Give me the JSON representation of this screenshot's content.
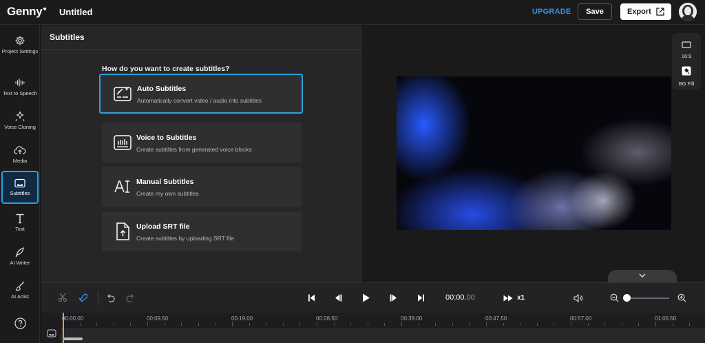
{
  "app": {
    "logo": "Genny",
    "logo_mark": "♥",
    "project_title": "Untitled"
  },
  "header": {
    "upgrade_label": "UPGRADE",
    "save_label": "Save",
    "export_label": "Export"
  },
  "sidebar": {
    "items": [
      {
        "label": "Project Settings",
        "icon": "gear-icon"
      },
      {
        "label": "Text to Speech",
        "icon": "waveform-icon"
      },
      {
        "label": "Voice Cloning",
        "icon": "sparkle-icon"
      },
      {
        "label": "Media",
        "icon": "cloud-upload-icon"
      },
      {
        "label": "Subtitles",
        "icon": "subtitles-icon",
        "active": true
      },
      {
        "label": "Text",
        "icon": "text-t-icon"
      },
      {
        "label": "AI Writer",
        "icon": "pen-icon"
      },
      {
        "label": "AI Artist",
        "icon": "brush-icon"
      },
      {
        "label": "",
        "icon": "help-icon"
      }
    ]
  },
  "panel": {
    "title": "Subtitles",
    "question": "How do you want to create subtitles?",
    "options": [
      {
        "title": "Auto Subtitles",
        "desc": "Automatically convert video / audio into subtitles",
        "icon": "auto-subtitles-icon",
        "selected": true
      },
      {
        "title": "Voice to Subtitles",
        "desc": "Create subtitles from generated voice blocks",
        "icon": "voice-subtitles-icon"
      },
      {
        "title": "Manual Subtitles",
        "desc": "Create my own subtitles",
        "icon": "manual-text-icon"
      },
      {
        "title": "Upload SRT file",
        "desc": "Create subtitles by uploading SRT file",
        "icon": "upload-file-icon"
      }
    ]
  },
  "preview": {
    "tools": [
      {
        "label": "16:9",
        "icon": "aspect-ratio-icon"
      },
      {
        "label": "BG Fill",
        "icon": "paint-bucket-icon"
      }
    ]
  },
  "transport": {
    "time_main": "00:00.",
    "time_frac": "00",
    "speed": "x1",
    "zoom_level": 0.0
  },
  "timeline": {
    "ticks": [
      "00:00.00",
      "00:09.50",
      "00:19.00",
      "00:28.50",
      "00:38.00",
      "00:47.50",
      "00:57.00",
      "01:06.50"
    ]
  },
  "colors": {
    "accent": "#2aa1d8",
    "upgrade": "#3a8ee6",
    "playhead": "#e0a83a"
  }
}
